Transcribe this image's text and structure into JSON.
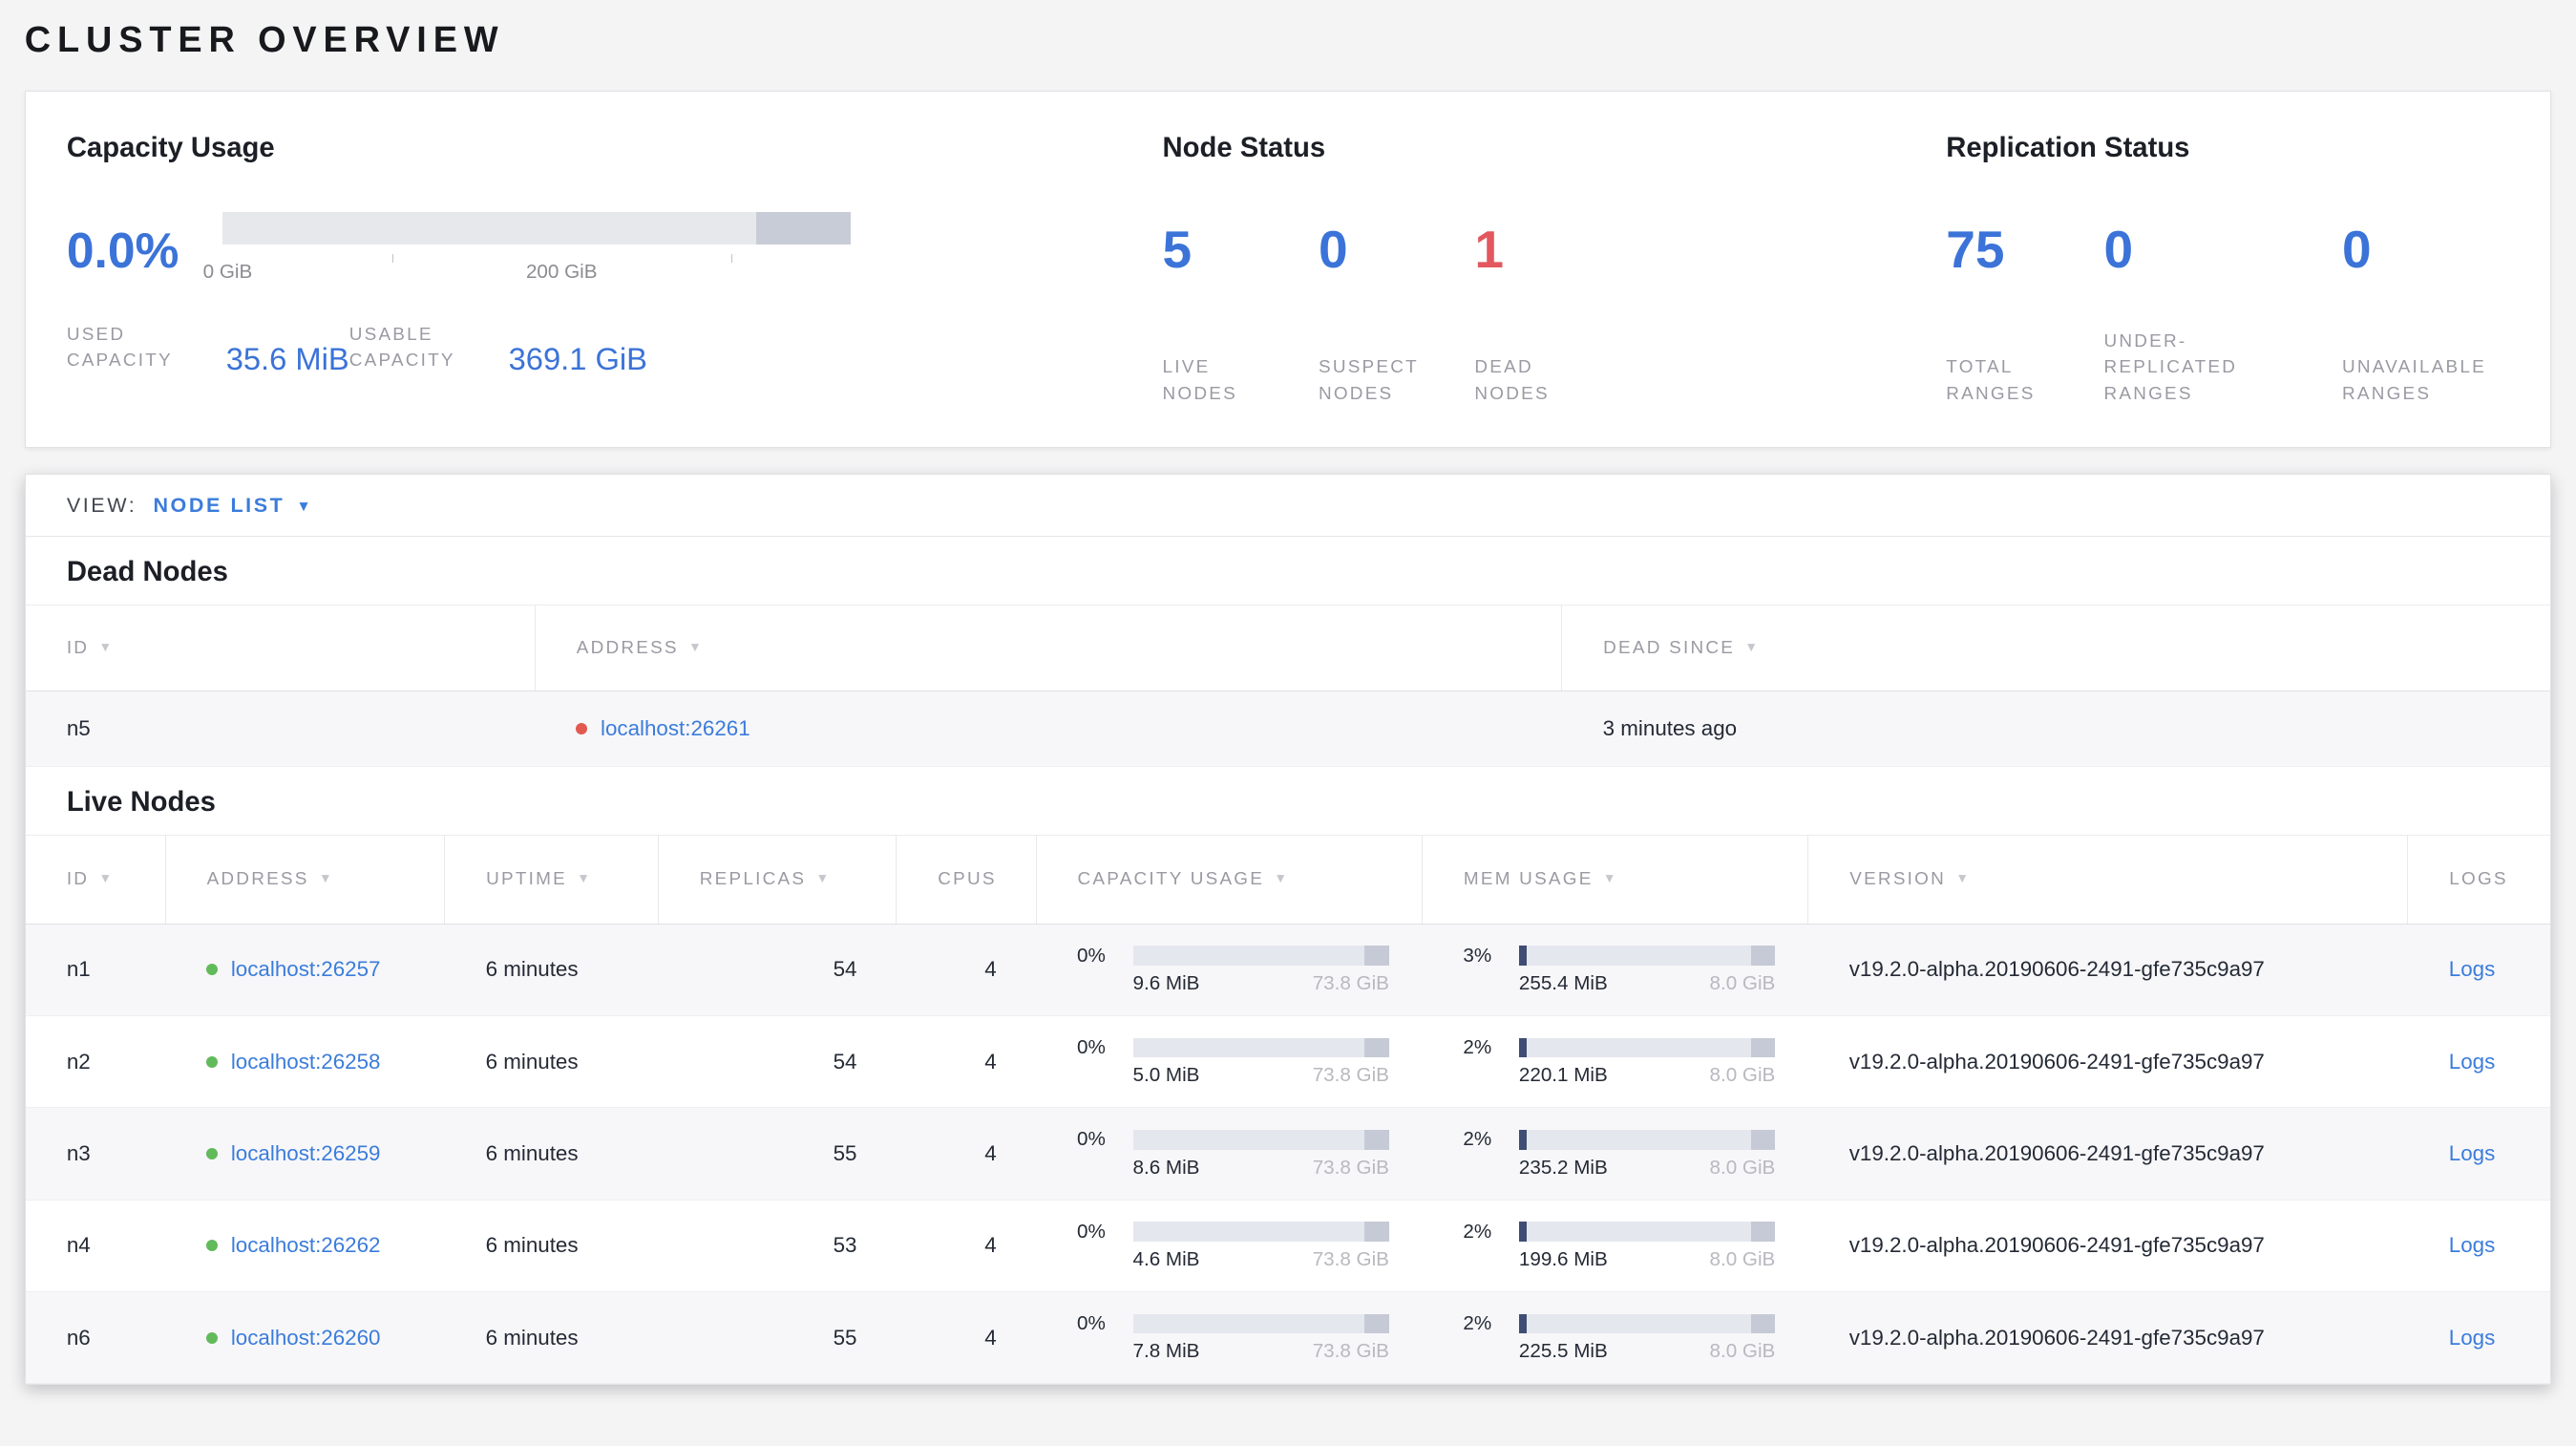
{
  "colors": {
    "accent_blue": "#3b73d8",
    "link_blue": "#3b7cdb",
    "danger_red": "#e2585e",
    "live_green": "#62ba5b",
    "dead_red": "#e25950"
  },
  "header": {
    "title": "CLUSTER OVERVIEW"
  },
  "summary": {
    "capacity": {
      "title": "Capacity Usage",
      "percent": "0.0%",
      "axis_tick_labels": [
        "0 GiB",
        "200 GiB"
      ],
      "stats": [
        {
          "label": "USED CAPACITY",
          "value": "35.6 MiB"
        },
        {
          "label": "USABLE CAPACITY",
          "value": "369.1 GiB"
        }
      ]
    },
    "node_status": {
      "title": "Node Status",
      "stats": [
        {
          "value": "5",
          "label": "LIVE NODES",
          "tone": "blue"
        },
        {
          "value": "0",
          "label": "SUSPECT NODES",
          "tone": "blue"
        },
        {
          "value": "1",
          "label": "DEAD NODES",
          "tone": "red"
        }
      ]
    },
    "replication": {
      "title": "Replication Status",
      "stats": [
        {
          "value": "75",
          "label": "TOTAL RANGES",
          "tone": "blue"
        },
        {
          "value": "0",
          "label": "UNDER-REPLICATED RANGES",
          "tone": "blue"
        },
        {
          "value": "0",
          "label": "UNAVAILABLE RANGES",
          "tone": "blue"
        }
      ]
    }
  },
  "view_bar": {
    "label": "VIEW:",
    "selected": "NODE LIST"
  },
  "dead_nodes": {
    "title": "Dead Nodes",
    "columns": [
      {
        "label": "ID",
        "sort": true
      },
      {
        "label": "ADDRESS",
        "sort": true
      },
      {
        "label": "DEAD SINCE",
        "sort": true
      }
    ],
    "rows": [
      {
        "id": "n5",
        "address": "localhost:26261",
        "dead_since": "3 minutes ago"
      }
    ]
  },
  "live_nodes": {
    "title": "Live Nodes",
    "columns": [
      {
        "label": "ID",
        "sort": true
      },
      {
        "label": "ADDRESS",
        "sort": true
      },
      {
        "label": "UPTIME",
        "sort": true
      },
      {
        "label": "REPLICAS",
        "sort": true
      },
      {
        "label": "CPUS",
        "sort": false
      },
      {
        "label": "CAPACITY USAGE",
        "sort": true
      },
      {
        "label": "MEM USAGE",
        "sort": true
      },
      {
        "label": "VERSION",
        "sort": true
      },
      {
        "label": "LOGS",
        "sort": false
      }
    ],
    "rows": [
      {
        "id": "n1",
        "address": "localhost:26257",
        "uptime": "6 minutes",
        "replicas": "54",
        "cpus": "4",
        "capacity_pct": "0%",
        "capacity_used": "9.6 MiB",
        "capacity_total": "73.8 GiB",
        "mem_pct": "3%",
        "mem_used": "255.4 MiB",
        "mem_total": "8.0 GiB",
        "version": "v19.2.0-alpha.20190606-2491-gfe735c9a97",
        "logs_label": "Logs"
      },
      {
        "id": "n2",
        "address": "localhost:26258",
        "uptime": "6 minutes",
        "replicas": "54",
        "cpus": "4",
        "capacity_pct": "0%",
        "capacity_used": "5.0 MiB",
        "capacity_total": "73.8 GiB",
        "mem_pct": "2%",
        "mem_used": "220.1 MiB",
        "mem_total": "8.0 GiB",
        "version": "v19.2.0-alpha.20190606-2491-gfe735c9a97",
        "logs_label": "Logs"
      },
      {
        "id": "n3",
        "address": "localhost:26259",
        "uptime": "6 minutes",
        "replicas": "55",
        "cpus": "4",
        "capacity_pct": "0%",
        "capacity_used": "8.6 MiB",
        "capacity_total": "73.8 GiB",
        "mem_pct": "2%",
        "mem_used": "235.2 MiB",
        "mem_total": "8.0 GiB",
        "version": "v19.2.0-alpha.20190606-2491-gfe735c9a97",
        "logs_label": "Logs"
      },
      {
        "id": "n4",
        "address": "localhost:26262",
        "uptime": "6 minutes",
        "replicas": "53",
        "cpus": "4",
        "capacity_pct": "0%",
        "capacity_used": "4.6 MiB",
        "capacity_total": "73.8 GiB",
        "mem_pct": "2%",
        "mem_used": "199.6 MiB",
        "mem_total": "8.0 GiB",
        "version": "v19.2.0-alpha.20190606-2491-gfe735c9a97",
        "logs_label": "Logs"
      },
      {
        "id": "n6",
        "address": "localhost:26260",
        "uptime": "6 minutes",
        "replicas": "55",
        "cpus": "4",
        "capacity_pct": "0%",
        "capacity_used": "7.8 MiB",
        "capacity_total": "73.8 GiB",
        "mem_pct": "2%",
        "mem_used": "225.5 MiB",
        "mem_total": "8.0 GiB",
        "version": "v19.2.0-alpha.20190606-2491-gfe735c9a97",
        "logs_label": "Logs"
      }
    ]
  }
}
